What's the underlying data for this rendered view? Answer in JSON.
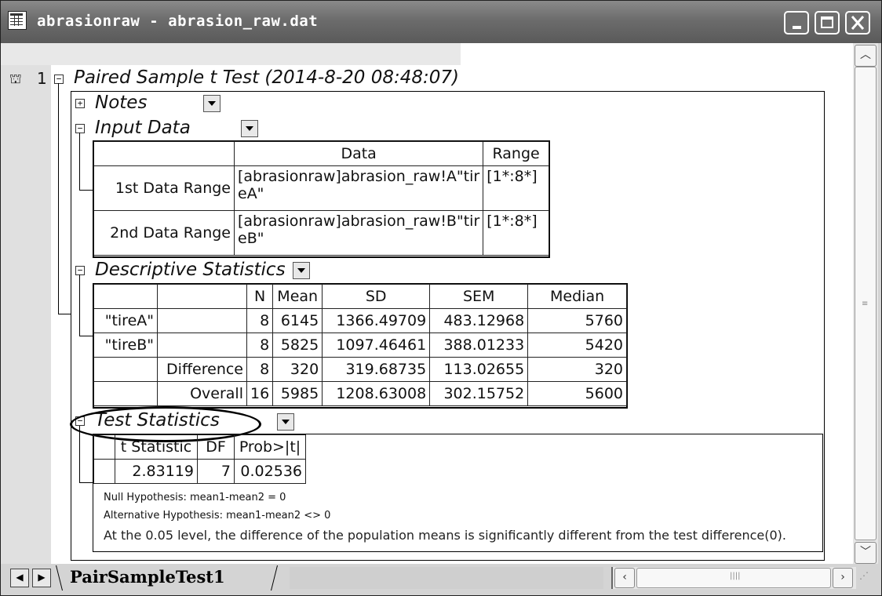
{
  "window": {
    "title": "abrasionraw - abrasion_raw.dat"
  },
  "report": {
    "row_number": "1",
    "title": "Paired Sample t Test (2014-8-20 08:48:07)",
    "sections": {
      "notes": "Notes",
      "input_data": "Input Data",
      "descriptive": "Descriptive Statistics",
      "test_stats": "Test Statistics"
    },
    "input_table": {
      "headers": [
        "Data",
        "Range"
      ],
      "rows": [
        {
          "label": "1st Data Range",
          "data": "[abrasionraw]abrasion_raw!A\"tir",
          "data2": "eA\"",
          "range": "[1*:8*]"
        },
        {
          "label": "2nd Data Range",
          "data": "[abrasionraw]abrasion_raw!B\"tir",
          "data2": "eB\"",
          "range": "[1*:8*]"
        }
      ]
    },
    "desc_table": {
      "headers": [
        "N",
        "Mean",
        "SD",
        "SEM",
        "Median"
      ],
      "rows": [
        {
          "c1": "\"tireA\"",
          "c2": "",
          "n": "8",
          "mean": "6145",
          "sd": "1366.49709",
          "sem": "483.12968",
          "median": "5760"
        },
        {
          "c1": "\"tireB\"",
          "c2": "",
          "n": "8",
          "mean": "5825",
          "sd": "1097.46461",
          "sem": "388.01233",
          "median": "5420"
        },
        {
          "c1": "",
          "c2": "Difference",
          "n": "8",
          "mean": "320",
          "sd": "319.68735",
          "sem": "113.02655",
          "median": "320"
        },
        {
          "c1": "",
          "c2": "Overall",
          "n": "16",
          "mean": "5985",
          "sd": "1208.63008",
          "sem": "302.15752",
          "median": "5600"
        }
      ]
    },
    "test_table": {
      "headers": [
        "t Statistic",
        "DF",
        "Prob>|t|"
      ],
      "values": [
        "2.83119",
        "7",
        "0.02536"
      ]
    },
    "null_hypothesis": "Null Hypothesis: mean1-mean2 = 0",
    "alt_hypothesis": "Alternative Hypothesis: mean1-mean2 <> 0",
    "conclusion": "At the 0.05 level, the difference of the population means is significantly different from the test difference(0)."
  },
  "sheet_tab": "PairSampleTest1",
  "icons": [
    "app-worksheet-icon",
    "lock-icon",
    "minimize-icon",
    "maximize-icon",
    "close-icon",
    "dropdown-arrow-icon",
    "scroll-up-icon",
    "scroll-down-icon",
    "scroll-left-icon",
    "scroll-right-icon"
  ]
}
